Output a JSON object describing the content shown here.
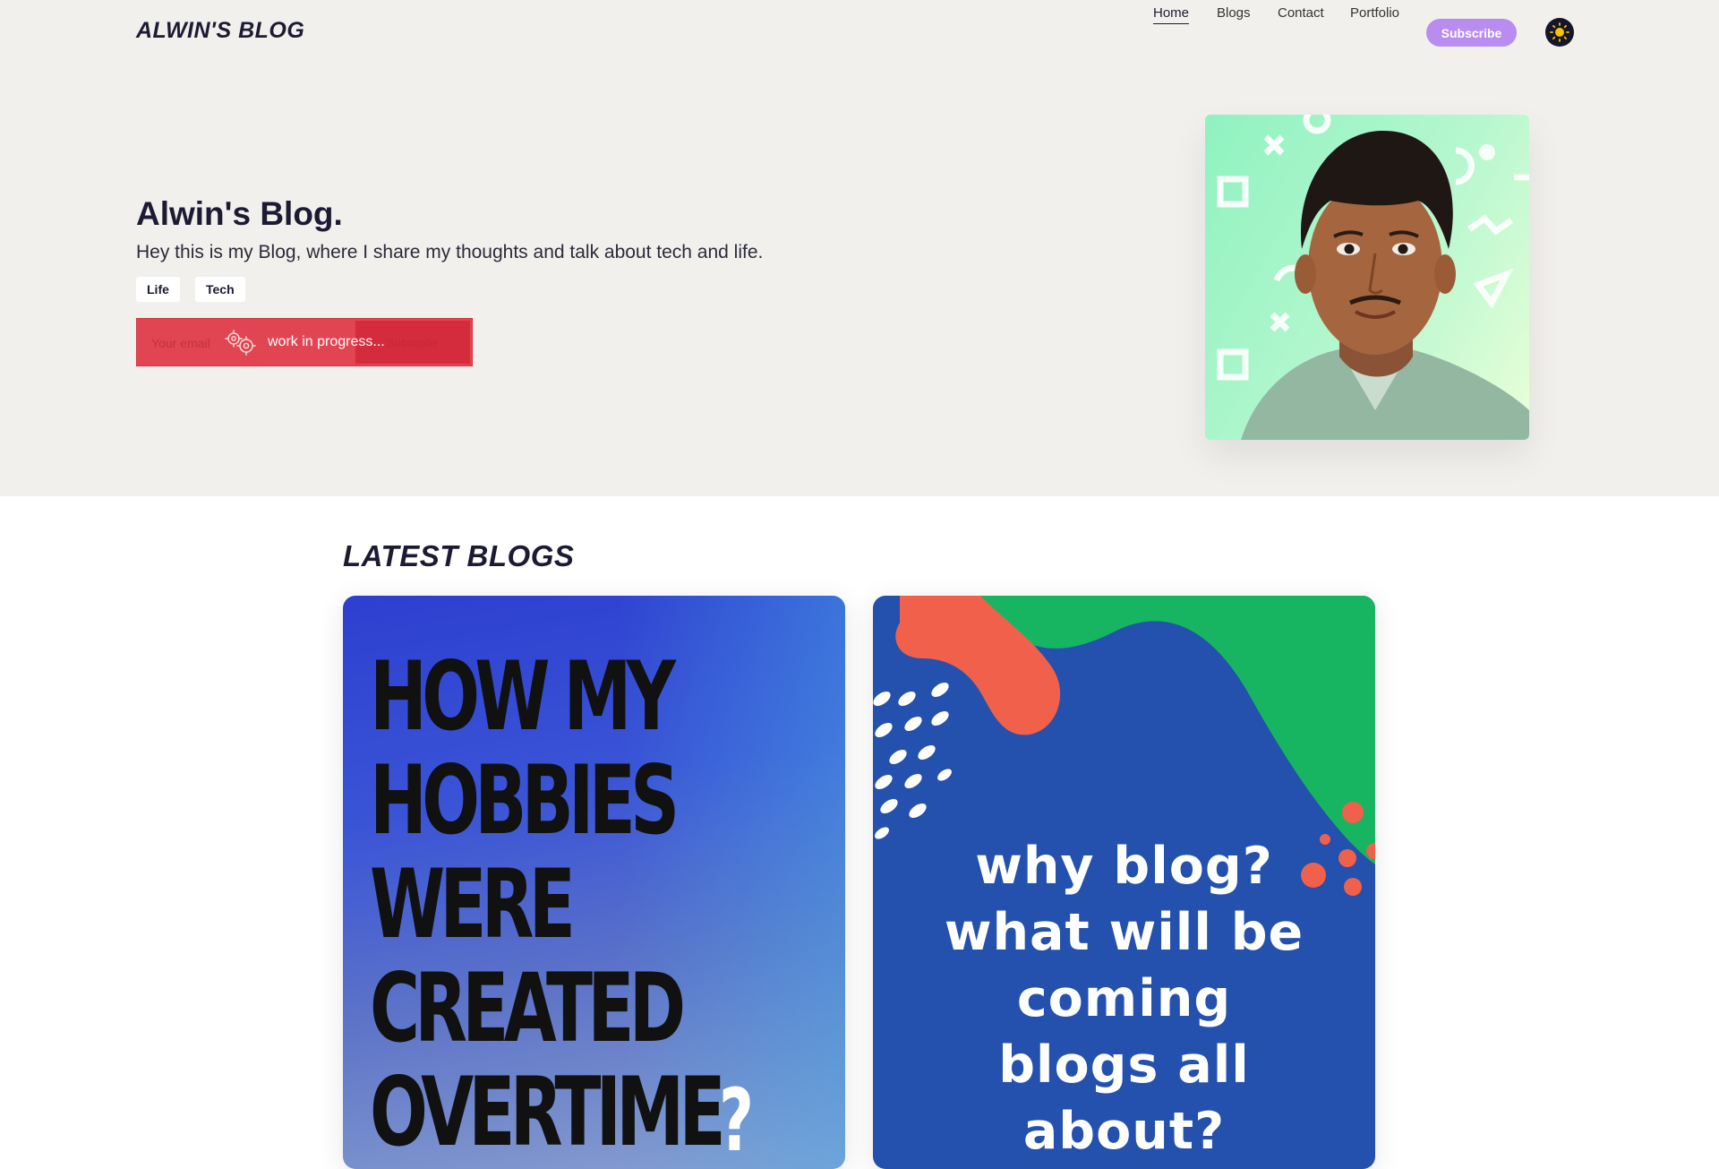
{
  "header": {
    "brand": "ALWIN'S BLOG",
    "nav": [
      {
        "label": "Home",
        "active": true
      },
      {
        "label": "Blogs",
        "active": false
      },
      {
        "label": "Contact",
        "active": false
      },
      {
        "label": "Portfolio",
        "active": false
      }
    ],
    "subscribe_label": "Subscribe",
    "theme_icon": "sun-icon"
  },
  "hero": {
    "title": "Alwin's Blog.",
    "subtitle": "Hey this is my Blog, where I share my thoughts and talk about tech and life.",
    "tags": [
      "Life",
      "Tech"
    ],
    "newsletter": {
      "input_placeholder": "Your email",
      "button_label": "Subscribe",
      "overlay_text": "work in progress...",
      "overlay_icon": "gears-icon"
    }
  },
  "latest": {
    "title": "LATEST BLOGS",
    "cards": [
      {
        "cover_text": "HOW MY\nHOBBIES\nWERE\nCREATED\nOVERTIME",
        "cover_mark": "?"
      },
      {
        "cover_text": "why blog?\nwhat will be\ncoming\nblogs all\nabout?"
      }
    ]
  },
  "colors": {
    "accent": "#b98cf0",
    "header_bg": "#f2f0ed",
    "wip_red": "#e24552",
    "card2_blue": "#2351ad",
    "card2_green": "#17b561",
    "card2_orange": "#f0604a"
  }
}
